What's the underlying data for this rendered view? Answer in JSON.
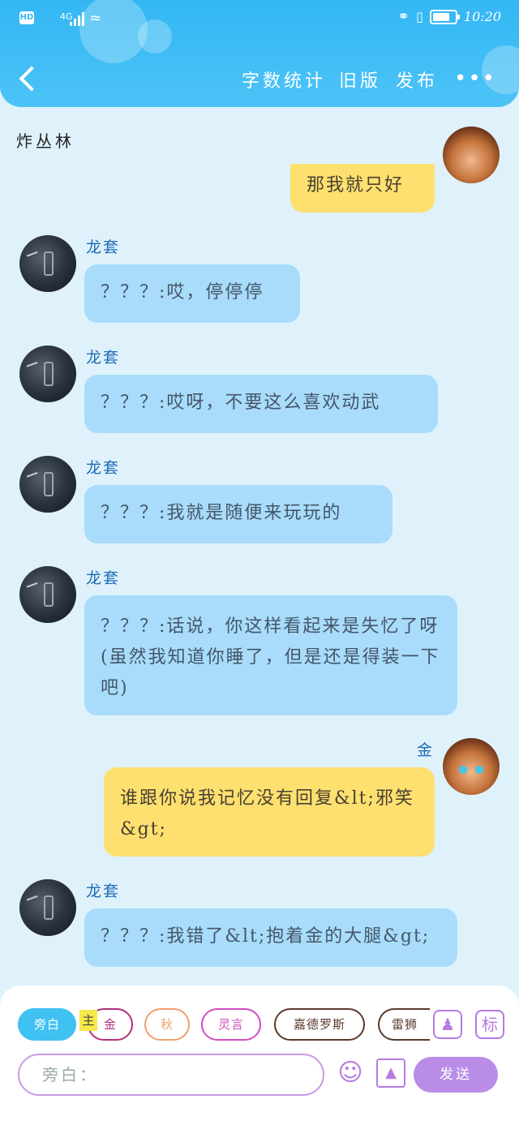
{
  "status_bar": {
    "hd": "HD",
    "network": "4G",
    "time": "10:20"
  },
  "nav": {
    "word_count": "字数统计",
    "old_version": "旧版",
    "publish": "发布",
    "more": "•••"
  },
  "chat": {
    "title": "炸丛林",
    "messages": [
      {
        "sender": "",
        "text": "那我就只好",
        "mine": true
      },
      {
        "sender": "龙套",
        "text": "？？？:哎，停停停",
        "mine": false
      },
      {
        "sender": "龙套",
        "text": "？？？:哎呀，不要这么喜欢动武",
        "mine": false
      },
      {
        "sender": "龙套",
        "text": "？？？:我就是随便来玩玩的",
        "mine": false
      },
      {
        "sender": "龙套",
        "text": "？？？:话说，你这样看起来是失忆了呀(虽然我知道你睡了，但是还是得装一下吧)",
        "mine": false
      },
      {
        "sender": "金",
        "text": "谁跟你说我记忆没有回复&lt;邪笑&gt;",
        "mine": true
      },
      {
        "sender": "龙套",
        "text": "？？？:我错了&lt;抱着金的大腿&gt;",
        "mine": false
      }
    ]
  },
  "composer": {
    "roles": [
      "旁白",
      "金",
      "秋",
      "灵言",
      "嘉德罗斯",
      "雷狮"
    ],
    "main_tag": "主",
    "mark_label": "标",
    "input_placeholder": "旁白：",
    "send_label": "发送"
  },
  "colors": {
    "header": "#33b7f3",
    "other_bubble": "#a8dcfa",
    "my_bubble": "#fde070",
    "accent_purple": "#b98de7"
  }
}
